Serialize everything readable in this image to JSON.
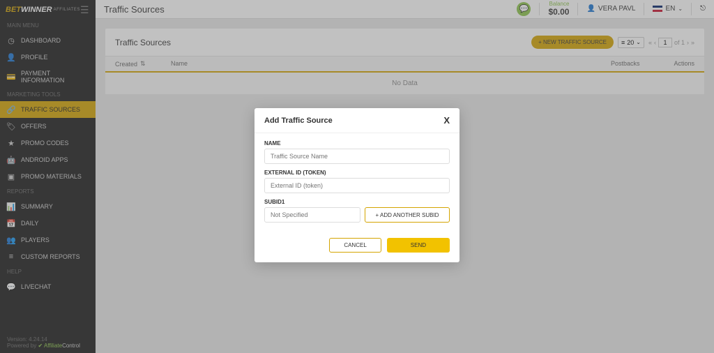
{
  "brand": {
    "bet": "BET",
    "winner": "WINNER",
    "affiliates": "AFFILIATES"
  },
  "header": {
    "title": "Traffic Sources",
    "balance_label": "Balance",
    "balance_value": "$0.00",
    "user": "VERA PAVL",
    "lang": "EN"
  },
  "sidebar": {
    "sections": {
      "main": "MAIN MENU",
      "marketing": "MARKETING TOOLS",
      "reports": "REPORTS",
      "help": "HELP"
    },
    "items": {
      "dashboard": "DASHBOARD",
      "profile": "PROFILE",
      "payment": "PAYMENT INFORMATION",
      "traffic": "TRAFFIC SOURCES",
      "offers": "OFFERS",
      "promo_codes": "PROMO CODES",
      "android": "ANDROID APPS",
      "promo_materials": "PROMO MATERIALS",
      "summary": "SUMMARY",
      "daily": "DAILY",
      "players": "PLAYERS",
      "custom": "CUSTOM REPORTS",
      "livechat": "LIVECHAT"
    }
  },
  "panel": {
    "title": "Traffic Sources",
    "new_btn": "+ NEW TRAFFIC SOURCE",
    "page_size": "20",
    "page_num": "1",
    "page_total": "of 1",
    "columns": {
      "created": "Created",
      "name": "Name",
      "postbacks": "Postbacks",
      "actions": "Actions"
    },
    "nodata": "No Data"
  },
  "modal": {
    "title": "Add Traffic Source",
    "name_label": "NAME",
    "name_placeholder": "Traffic Source Name",
    "ext_label": "EXTERNAL ID (TOKEN)",
    "ext_placeholder": "External ID (token)",
    "subid_label": "SUBID1",
    "subid_placeholder": "Not Specified",
    "add_subid": "+ ADD ANOTHER SUBID",
    "cancel": "CANCEL",
    "send": "SEND"
  },
  "footer": {
    "version": "Version: 4.24.14",
    "powered": "Powered by",
    "affiliate": "Affiliate",
    "control": "Control"
  }
}
